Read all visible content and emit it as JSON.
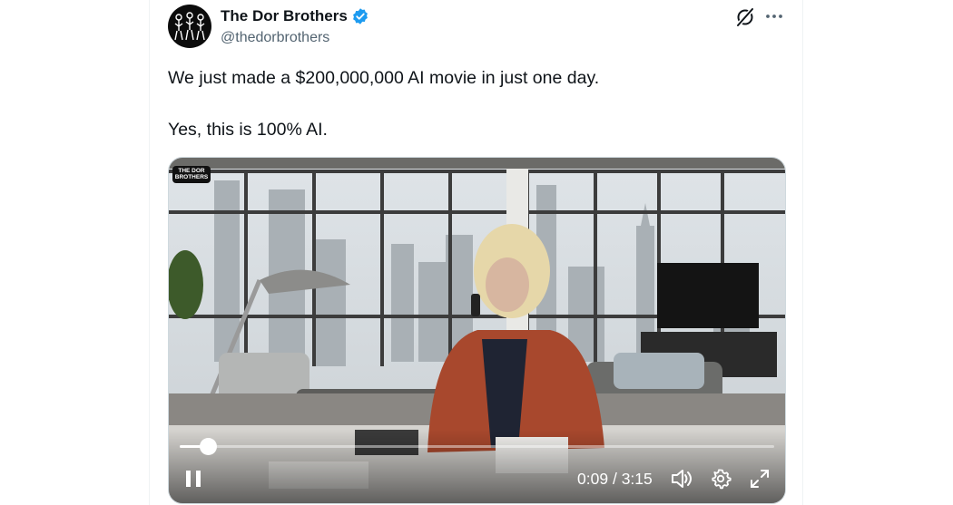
{
  "author": {
    "name": "The Dor Brothers",
    "handle": "@thedorbrothers"
  },
  "tweet": {
    "line1": "We just made a $200,000,000 AI movie in just one day.",
    "line2": "Yes, this is 100% AI."
  },
  "video": {
    "watermark_line1": "THE DOR",
    "watermark_line2": "BROTHERS",
    "elapsed": "0:09",
    "separator": "/",
    "duration": "3:15",
    "progress_fraction": 0.047
  },
  "icons": {
    "verified": "verified-badge-icon",
    "grok": "grok-icon",
    "more": "more-icon",
    "pause": "pause-icon",
    "volume": "volume-icon",
    "settings": "gear-icon",
    "fullscreen": "fullscreen-icon"
  },
  "colors": {
    "verified": "#1d9bf0",
    "secondary_text": "#536471"
  }
}
